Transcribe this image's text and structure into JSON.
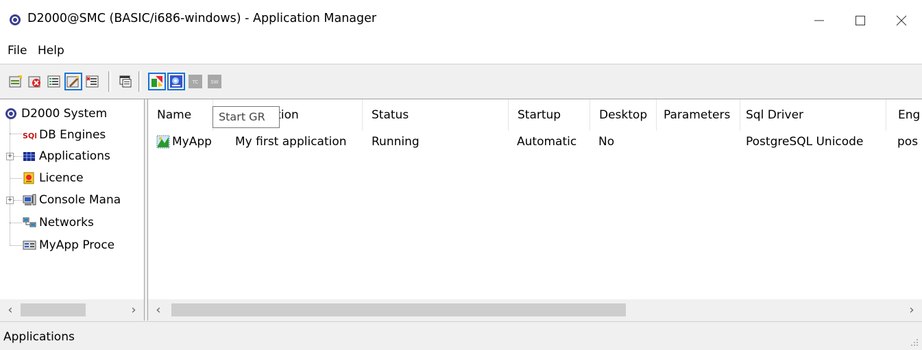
{
  "window": {
    "title": "D2000@SMC (BASIC/i686-windows) - Application Manager",
    "controls": [
      "minimize-icon",
      "maximize-icon",
      "close-icon"
    ]
  },
  "menu": {
    "items": [
      "File",
      "Help"
    ]
  },
  "toolbar": {
    "tooltip": "Start GR",
    "buttons": [
      "new-icon",
      "delete-icon",
      "list-icon",
      "edit-icon",
      "cut-icon",
      "window-icon",
      "start-gr-icon",
      "monitor-icon",
      "tc-icon",
      "sw-icon"
    ],
    "tc_label": "TC",
    "sw_label": "SW"
  },
  "tree": {
    "root": "D2000 System",
    "items": [
      {
        "label": "DB Engines",
        "icon": "sql-icon"
      },
      {
        "label": "Applications",
        "icon": "grid-icon"
      },
      {
        "label": "Licence",
        "icon": "licence-icon"
      },
      {
        "label": "Console Mana",
        "icon": "computer-icon"
      },
      {
        "label": "Networks",
        "icon": "network-icon"
      },
      {
        "label": "MyApp  Proce",
        "icon": "process-icon"
      }
    ]
  },
  "list": {
    "columns": [
      "Name",
      "Description",
      "Status",
      "Startup",
      "Desktop",
      "Parameters",
      "Sql Driver",
      "Eng"
    ],
    "rows": [
      {
        "name": "MyApp",
        "description": "My first application",
        "status": "Running",
        "startup": "Automatic",
        "desktop": "No",
        "parameters": "",
        "sql_driver": "PostgreSQL Unicode",
        "engine": "pos"
      }
    ]
  },
  "statusbar": {
    "text": "Applications"
  },
  "colors": {
    "accent": "#1573d6",
    "window_bg": "#f0f0f0",
    "panel_bg": "#ffffff"
  }
}
